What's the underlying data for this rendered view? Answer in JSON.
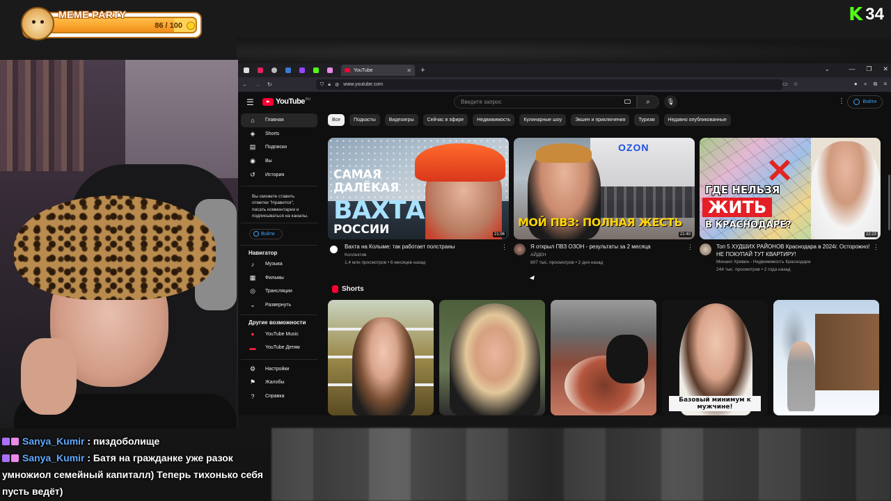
{
  "overlay": {
    "meme_party": {
      "title": "MEME PARTY",
      "count": "86 / 100",
      "progress": 0.86
    },
    "kick": {
      "logo": "K",
      "viewers": "34"
    }
  },
  "chat": [
    {
      "user": "Sanya_Kumir",
      "text": " : пиздоболище"
    },
    {
      "user": "Sanya_Kumir",
      "text": " : Батя на гражданке уже разок умножиол семейный капиталл) Теперь тихонько себя пусть ведёт)"
    }
  ],
  "browser": {
    "tab_title": "YouTube",
    "url": "www.youtube.com"
  },
  "youtube": {
    "logo": "YouTube",
    "logo_region": "RU",
    "search_placeholder": "Введите запрос",
    "signin": "Войти",
    "sidebar": {
      "main": [
        {
          "label": "Главная",
          "icon": "home-icon",
          "active": true
        },
        {
          "label": "Shorts",
          "icon": "shorts-icon"
        },
        {
          "label": "Подписки",
          "icon": "subscriptions-icon"
        },
        {
          "label": "Вы",
          "icon": "you-icon"
        },
        {
          "label": "История",
          "icon": "history-icon"
        }
      ],
      "note": "Вы сможете ставить отметки \"Нравится\", писать комментарии и подписываться на каналы.",
      "signin": "Войти",
      "nav_title": "Навигатор",
      "nav": [
        {
          "label": "Музыка",
          "icon": "music-icon"
        },
        {
          "label": "Фильмы",
          "icon": "movies-icon"
        },
        {
          "label": "Трансляции",
          "icon": "live-icon"
        },
        {
          "label": "Развернуть",
          "icon": "chevron-down-icon"
        }
      ],
      "more_title": "Другие возможности",
      "more": [
        {
          "label": "YouTube Music",
          "icon": "yt-music-icon"
        },
        {
          "label": "YouTube Детям",
          "icon": "yt-kids-icon"
        }
      ],
      "settings": [
        {
          "label": "Настройки",
          "icon": "settings-icon"
        },
        {
          "label": "Жалобы",
          "icon": "flag-icon"
        },
        {
          "label": "Справка",
          "icon": "help-icon"
        }
      ]
    },
    "chips": [
      "Все",
      "Подкасты",
      "Видеоигры",
      "Сейчас в эфире",
      "Недвижимость",
      "Кулинарные шоу",
      "Экшен и приключения",
      "Туризм",
      "Недавно опубликованные"
    ],
    "videos": [
      {
        "title": "Вахта на Колыме: так работает полстраны",
        "channel": "Коллектив",
        "stats": "1,4 млн просмотров • 6 месяцев назад",
        "duration": "21:06",
        "thumb_text": [
          "САМАЯ",
          "ДАЛЁКАЯ",
          "ВАХТА",
          "РОССИИ"
        ]
      },
      {
        "title": "Я открыл ПВЗ ОЗОН - результаты за 2 месяца",
        "channel": "АЙДЕН",
        "stats": "807 тыс. просмотров • 2 дня назад",
        "duration": "21:40",
        "thumb_text": [
          "OZON",
          "МОЙ ПВЗ: ПОЛНАЯ ЖЕСТЬ"
        ]
      },
      {
        "title": "Топ 5 ХУДШИХ РАЙОНОВ Краснодара в 2024г. Осторожно! НЕ ПОКУПАЙ ТУТ КВАРТИРУ!",
        "channel": "Михаил Хрявин - Недвижимость Краснодара",
        "stats": "244 тыс. просмотров • 2 года назад",
        "duration": "22:23",
        "thumb_text": [
          "ГДЕ НЕЛЬЗЯ",
          "ЖИТЬ",
          "В КРАСНОДАРЕ?"
        ]
      }
    ],
    "shorts_title": "Shorts",
    "shorts_captions": [
      "",
      "",
      "",
      "Базовый минимум к мужчине!",
      ""
    ]
  }
}
